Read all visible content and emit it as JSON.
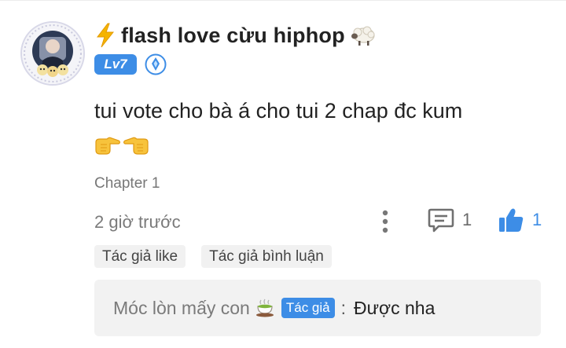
{
  "comment": {
    "username": "flash love cừu hiphop",
    "level_badge": "Lv7",
    "text": "tui vote cho bà á cho tui 2 chap đc kum",
    "chapter": "Chapter 1",
    "time": "2 giờ trước",
    "reply_count": "1",
    "like_count": "1",
    "icons": {
      "prefix": "lightning-emoji",
      "suffix": "sheep-emoji",
      "rank": "rank-crystal-icon",
      "emoji": [
        "pointing-right-emoji",
        "pointing-left-emoji"
      ],
      "more": "vertical-dots-icon",
      "reply": "comment-bubble-icon",
      "like": "thumbs-up-icon"
    },
    "tags": [
      "Tác giả like",
      "Tác giả bình luận"
    ]
  },
  "reply": {
    "author": "Móc lòn mấy con",
    "author_icon": "tea-cup-emoji",
    "badge": "Tác giả",
    "separator": ":",
    "text": "Được nha"
  },
  "colors": {
    "accent": "#3d8de6",
    "muted_text": "#7a7a7a",
    "tag_bg": "#f1f1f1",
    "reply_bg": "#f2f2f2"
  }
}
